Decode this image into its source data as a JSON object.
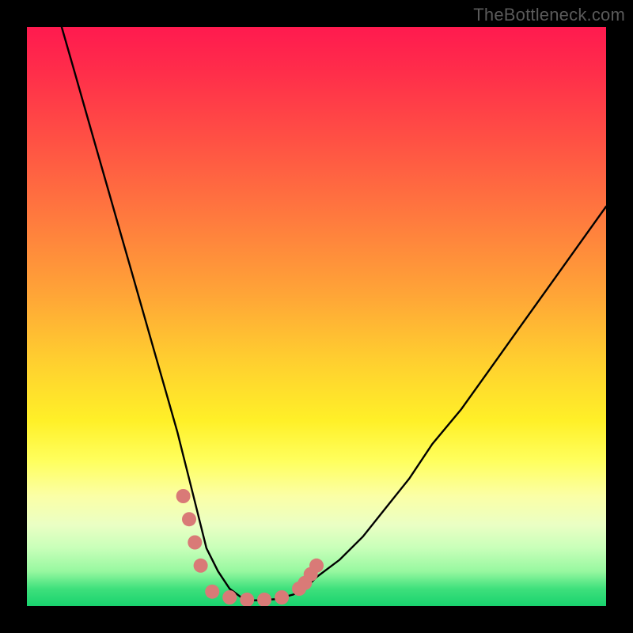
{
  "watermark": "TheBottleneck.com",
  "chart_data": {
    "type": "line",
    "title": "",
    "xlabel": "",
    "ylabel": "",
    "xlim": [
      0,
      100
    ],
    "ylim": [
      0,
      100
    ],
    "grid": false,
    "series": [
      {
        "name": "curve",
        "color": "#000000",
        "x": [
          6,
          8,
          10,
          12,
          14,
          16,
          18,
          20,
          22,
          24,
          26,
          27,
          28,
          29,
          30,
          31,
          33,
          35,
          37,
          38,
          40,
          43,
          46,
          48,
          50,
          54,
          58,
          62,
          66,
          70,
          75,
          80,
          85,
          90,
          95,
          100
        ],
        "values": [
          100,
          93,
          86,
          79,
          72,
          65,
          58,
          51,
          44,
          37,
          30,
          26,
          22,
          18,
          14,
          10,
          6,
          3,
          1.5,
          1,
          1,
          1.2,
          2,
          3,
          5,
          8,
          12,
          17,
          22,
          28,
          34,
          41,
          48,
          55,
          62,
          69
        ]
      }
    ],
    "highlight": {
      "description": "pink marker band near curve minimum",
      "color": "#d97a77",
      "segments": [
        {
          "x": [
            27,
            28,
            29,
            30
          ],
          "y": [
            19,
            15,
            11,
            7
          ]
        },
        {
          "x": [
            32,
            35,
            38,
            41,
            44
          ],
          "y": [
            2.5,
            1.5,
            1.1,
            1.1,
            1.5
          ]
        },
        {
          "x": [
            47,
            48,
            49,
            50
          ],
          "y": [
            3,
            4,
            5.5,
            7
          ]
        }
      ]
    },
    "gradient_stops": [
      {
        "pct": 0,
        "color": "#ff1a4f"
      },
      {
        "pct": 20,
        "color": "#ff5244"
      },
      {
        "pct": 46,
        "color": "#ffa437"
      },
      {
        "pct": 68,
        "color": "#fff028"
      },
      {
        "pct": 86,
        "color": "#eaffc4"
      },
      {
        "pct": 100,
        "color": "#18d36e"
      }
    ]
  }
}
